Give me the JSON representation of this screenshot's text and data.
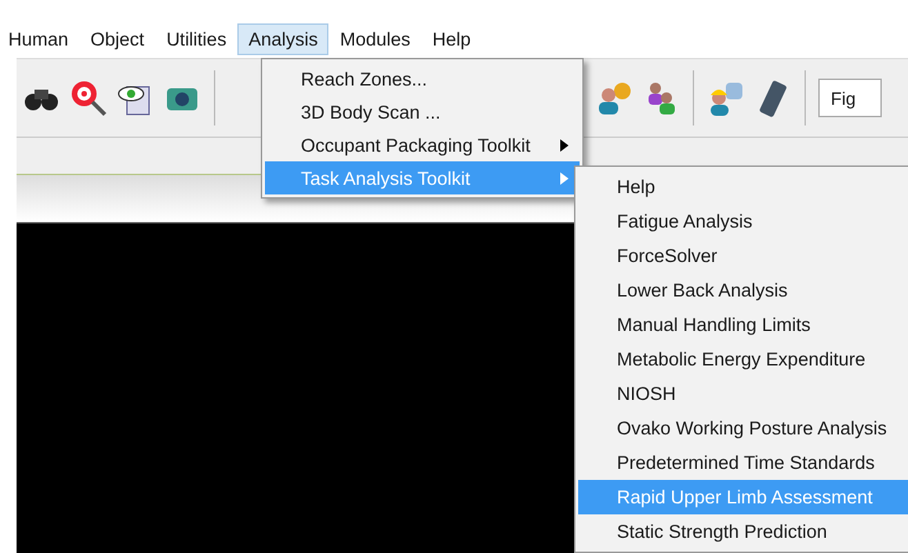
{
  "menu_bar": [
    {
      "label": "Human",
      "selected": false
    },
    {
      "label": "Object",
      "selected": false
    },
    {
      "label": "Utilities",
      "selected": false
    },
    {
      "label": "Analysis",
      "selected": true
    },
    {
      "label": "Modules",
      "selected": false
    },
    {
      "label": "Help",
      "selected": false
    }
  ],
  "toolbar": {
    "field_value": "Fig"
  },
  "analysis_menu": [
    {
      "label": "Reach Zones...",
      "has_submenu": false,
      "selected": false
    },
    {
      "label": "3D Body Scan ...",
      "has_submenu": false,
      "selected": false
    },
    {
      "label": "Occupant Packaging Toolkit",
      "has_submenu": true,
      "selected": false
    },
    {
      "label": "Task Analysis Toolkit",
      "has_submenu": true,
      "selected": true
    }
  ],
  "task_analysis_submenu": [
    {
      "label": "Help",
      "selected": false
    },
    {
      "label": "Fatigue Analysis",
      "selected": false
    },
    {
      "label": "ForceSolver",
      "selected": false
    },
    {
      "label": "Lower Back Analysis",
      "selected": false
    },
    {
      "label": "Manual Handling Limits",
      "selected": false
    },
    {
      "label": "Metabolic Energy Expenditure",
      "selected": false
    },
    {
      "label": "NIOSH",
      "selected": false
    },
    {
      "label": "Ovako Working Posture Analysis",
      "selected": false
    },
    {
      "label": "Predetermined Time Standards",
      "selected": false
    },
    {
      "label": "Rapid Upper Limb Assessment",
      "selected": true
    },
    {
      "label": "Static Strength Prediction",
      "selected": false
    }
  ]
}
